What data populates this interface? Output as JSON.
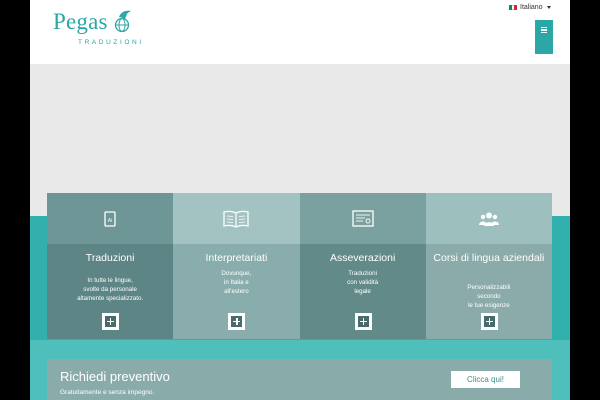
{
  "brand": {
    "name": "Pegas",
    "tagline": "TRADUZIONI"
  },
  "language": {
    "selected": "Italiano",
    "flag_colors": [
      "#009246",
      "#ffffff",
      "#ce2b37"
    ]
  },
  "menu": {
    "icon": "hamburger-icon",
    "color": "#2aa7a6"
  },
  "colors": {
    "accent": "#2aa7a6",
    "band": "#31b0ad",
    "hero": "#e9e9e9"
  },
  "services": [
    {
      "icon": "book-icon",
      "title": "Traduzioni",
      "desc_lines": [
        "In tutte le lingue,",
        "svolte da personale",
        "altamente specializzato."
      ],
      "top_color": "#6e9696",
      "bottom_color": "#5d8585"
    },
    {
      "icon": "open-book-icon",
      "title": "Interpretariati",
      "desc_lines": [
        "Dovunque,",
        "in Italia e",
        "all'estero"
      ],
      "top_color": "#a3c3c2",
      "bottom_color": "#89adac"
    },
    {
      "icon": "certificate-icon",
      "title": "Asseverazioni",
      "desc_lines": [
        "Traduzioni",
        "con validità",
        "legale"
      ],
      "top_color": "#7aa09f",
      "bottom_color": "#628a89"
    },
    {
      "icon": "group-icon",
      "title": "Corsi di lingua aziendali",
      "desc_lines": [
        "Personalizzabili",
        "secondo",
        "le tue esigenze"
      ],
      "top_color": "#9dbfbe",
      "bottom_color": "#8aabaa"
    }
  ],
  "quote": {
    "title": "Richiedi preventivo",
    "subtitle": "Gratuitamente e senza impegno.",
    "button_label": "Clicca qui!"
  }
}
